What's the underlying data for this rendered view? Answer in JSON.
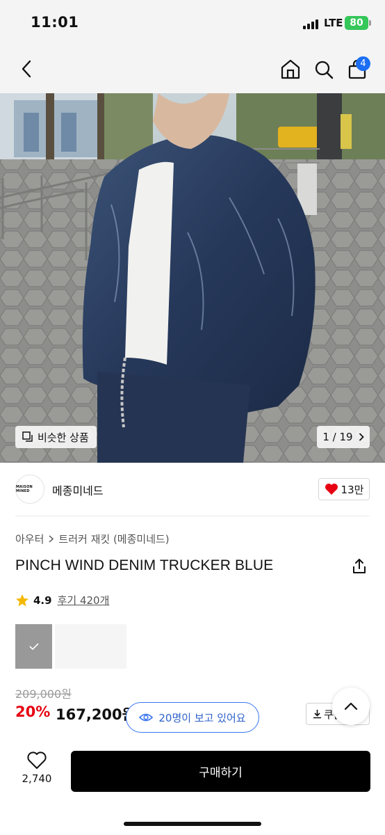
{
  "status_bar": {
    "time": "11:01",
    "network": "LTE",
    "battery": "80"
  },
  "nav": {
    "cart_count": "4",
    "icons": [
      "back-icon",
      "home-icon",
      "search-icon",
      "cart-icon"
    ]
  },
  "gallery": {
    "similar_label": "비슷한 상품",
    "counter": "1 / 19"
  },
  "brand": {
    "logo_text": "MAISON MINED",
    "name": "메종미네드",
    "likes": "13만"
  },
  "breadcrumb": {
    "category": "아우터",
    "subcategory": "트러커 재킷 (메종미네드)"
  },
  "product": {
    "title": "PINCH WIND DENIM TRUCKER BLUE",
    "rating": "4.9",
    "review_label": "후기 420개",
    "original_price": "209,000원",
    "discount": "20%",
    "sale_price": "167,200원",
    "coupon_label": "쿠폰"
  },
  "viewers": {
    "label": "20명이 보고 있어요"
  },
  "bottom": {
    "wish_count": "2,740",
    "buy_label": "구매하기"
  },
  "colors": {
    "accent_blue": "#3a76f0",
    "sale_red": "#e60012",
    "buy_black": "#000000",
    "battery_green": "#34c759"
  }
}
